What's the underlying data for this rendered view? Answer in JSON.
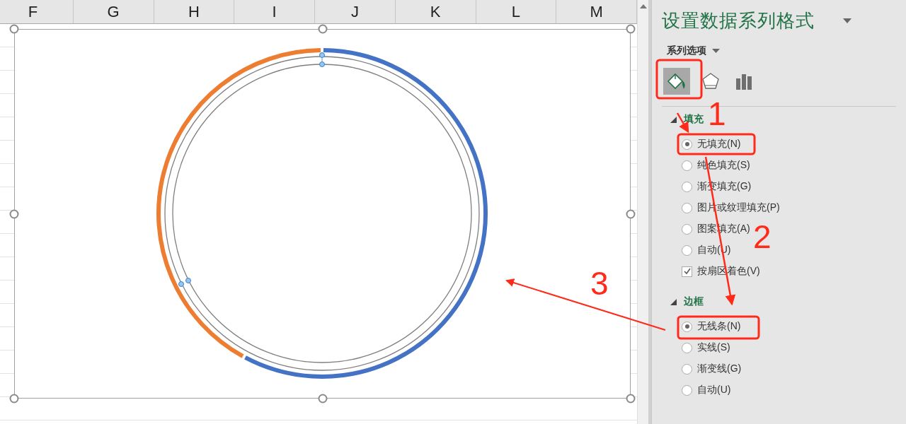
{
  "sheet": {
    "columns": [
      "F",
      "G",
      "H",
      "I",
      "J",
      "K",
      "L",
      "M"
    ]
  },
  "pane": {
    "title": "设置数据系列格式",
    "options_label": "系列选项",
    "icon_tabs": [
      {
        "kind": "fill",
        "selected": true
      },
      {
        "kind": "effects",
        "selected": false
      },
      {
        "kind": "series",
        "selected": false
      }
    ],
    "sections": [
      {
        "title": "填充",
        "expanded": true,
        "options": [
          {
            "kind": "radio",
            "label": "无填充(N)",
            "selected": true
          },
          {
            "kind": "radio",
            "label": "纯色填充(S)",
            "selected": false
          },
          {
            "kind": "radio",
            "label": "渐变填充(G)",
            "selected": false
          },
          {
            "kind": "radio",
            "label": "图片或纹理填充(P)",
            "selected": false
          },
          {
            "kind": "radio",
            "label": "图案填充(A)",
            "selected": false
          },
          {
            "kind": "radio",
            "label": "自动(U)",
            "selected": false
          },
          {
            "kind": "checkbox",
            "label": "按扇区着色(V)",
            "checked": true
          }
        ]
      },
      {
        "title": "边框",
        "expanded": true,
        "options": [
          {
            "kind": "radio",
            "label": "无线条(N)",
            "selected": true
          },
          {
            "kind": "radio",
            "label": "实线(S)",
            "selected": false
          },
          {
            "kind": "radio",
            "label": "渐变线(G)",
            "selected": false
          },
          {
            "kind": "radio",
            "label": "自动(U)",
            "selected": false
          }
        ]
      }
    ]
  },
  "annotations": [
    {
      "label": "1"
    },
    {
      "label": "2"
    },
    {
      "label": "3"
    }
  ]
}
